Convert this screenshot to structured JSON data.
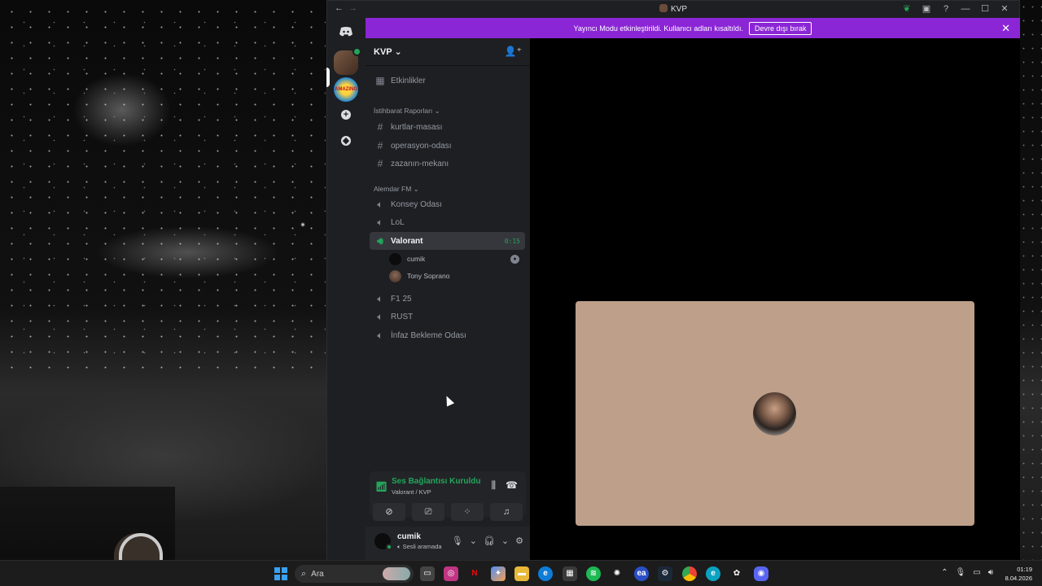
{
  "window": {
    "title": "KVP"
  },
  "banner": {
    "message": "Yayıncı Modu etkinleştirildi. Kullanıcı adları kısaltıldı.",
    "button": "Devre dışı bırak"
  },
  "server": {
    "name": "KVP"
  },
  "events_label": "Etkinlikler",
  "categories": [
    {
      "name": "İstihbarat Raporları",
      "channels": [
        "kurtlar-masası",
        "operasyon-odası",
        "zazanın-mekanı"
      ]
    },
    {
      "name": "Alemdar FM",
      "channels": [
        "Konsey Odası",
        "LoL",
        "Valorant",
        "F1 25",
        "RUST",
        "İnfaz Bekleme Odası"
      ]
    }
  ],
  "active_channel": {
    "name": "Valorant",
    "timer": "0:15"
  },
  "voice_members": [
    "cumik",
    "Tony Soprano"
  ],
  "voice_panel": {
    "status": "Ses Bağlantısı Kuruldu",
    "location": "Valorant / KVP"
  },
  "user": {
    "name": "cumik",
    "status": "Sesli aramada"
  },
  "taskbar": {
    "search": "Ara",
    "time": "01:19",
    "date": "8.04.2026"
  },
  "colors": {
    "accent_green": "#23a55a",
    "banner": "#8b26d6",
    "tile": "#bd9f8a"
  }
}
